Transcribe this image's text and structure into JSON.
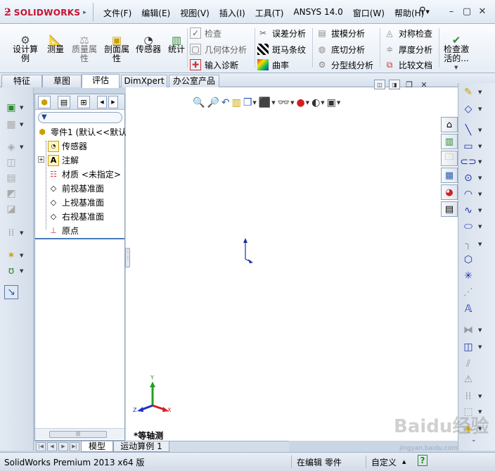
{
  "app": {
    "logo": "SOLIDWORKS",
    "menus": [
      "文件(F)",
      "编辑(E)",
      "视图(V)",
      "插入(I)",
      "工具(T)",
      "ANSYS 14.0",
      "窗口(W)",
      "帮助(H)"
    ]
  },
  "commandmanager": {
    "large_buttons": [
      {
        "label": "设计算\n例",
        "icon": "design-study-icon"
      },
      {
        "label": "测量",
        "icon": "measure-icon"
      },
      {
        "label": "质量属\n性",
        "icon": "mass-properties-icon"
      },
      {
        "label": "剖面属\n性",
        "icon": "section-properties-icon"
      },
      {
        "label": "传感器",
        "icon": "sensor-icon"
      },
      {
        "label": "统计",
        "icon": "statistics-icon"
      },
      {
        "label": "检查激\n活的...",
        "icon": "check-active-icon"
      }
    ],
    "small_buttons": [
      {
        "label": "检查",
        "icon": "check-icon",
        "enabled": false
      },
      {
        "label": "几何体分析",
        "icon": "geometry-analysis-icon",
        "enabled": false
      },
      {
        "label": "输入诊断",
        "icon": "import-diagnostics-icon",
        "enabled": true
      },
      {
        "label": "误差分析",
        "icon": "deviation-analysis-icon",
        "enabled": true
      },
      {
        "label": "斑马条纹",
        "icon": "zebra-stripes-icon",
        "enabled": true
      },
      {
        "label": "曲率",
        "icon": "curvature-icon",
        "enabled": true
      },
      {
        "label": "拔模分析",
        "icon": "draft-analysis-icon",
        "enabled": true
      },
      {
        "label": "底切分析",
        "icon": "undercut-analysis-icon",
        "enabled": true
      },
      {
        "label": "分型线分析",
        "icon": "parting-line-analysis-icon",
        "enabled": true
      },
      {
        "label": "对称检查",
        "icon": "symmetry-check-icon",
        "enabled": true
      },
      {
        "label": "厚度分析",
        "icon": "thickness-analysis-icon",
        "enabled": true
      },
      {
        "label": "比较文档",
        "icon": "compare-documents-icon",
        "enabled": true
      }
    ]
  },
  "tabs": {
    "items": [
      "特征",
      "草图",
      "评估",
      "DimXpert",
      "办公室产品"
    ],
    "active_index": 2
  },
  "featuretree": {
    "items": [
      {
        "label": "零件1 (默认<<默认",
        "icon": "part-icon"
      },
      {
        "label": "传感器",
        "icon": "sensor-folder-icon"
      },
      {
        "label": "注解",
        "icon": "annotations-icon"
      },
      {
        "label": "材质 <未指定>",
        "icon": "material-icon"
      },
      {
        "label": "前视基准面",
        "icon": "plane-icon"
      },
      {
        "label": "上视基准面",
        "icon": "plane-icon"
      },
      {
        "label": "右视基准面",
        "icon": "plane-icon"
      },
      {
        "label": "原点",
        "icon": "origin-icon"
      }
    ]
  },
  "graphics": {
    "view_label": "*等轴测",
    "triad": {
      "x": "X",
      "y": "Y",
      "z": "Z"
    }
  },
  "bottom_tabs": [
    "模型",
    "运动算例 1"
  ],
  "statusbar": {
    "product": "SolidWorks Premium 2013 x64 版",
    "state": "在编辑 零件",
    "units": "自定义",
    "help": "?"
  },
  "watermark": {
    "main": "Baidu经验",
    "sub": "jingyan.baidu.com"
  },
  "colors": {
    "accent": "#c8102e",
    "sketch_blue": "#1a2fa8",
    "frame": "#c9d6e6"
  }
}
